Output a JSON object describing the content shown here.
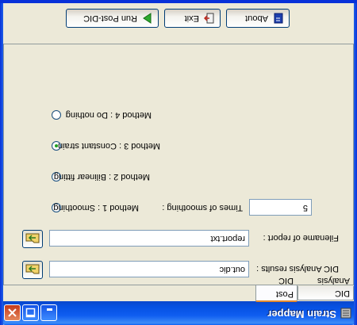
{
  "window": {
    "title": "Strain Mapper"
  },
  "tabs": [
    {
      "label": "DIC Analysis"
    },
    {
      "label": "Post DIC"
    }
  ],
  "fields": {
    "dic_results_label": "DIC Analysis results :",
    "dic_results_value": "out.dic",
    "report_label": "Filename of report :",
    "report_value": "report.txt",
    "smoothing_times_label": "Times of smoothing :",
    "smoothing_times_value": "5"
  },
  "methods": [
    {
      "label": "Method 1 : Smoothing",
      "selected": false
    },
    {
      "label": "Method 2 : Bilinear fitting",
      "selected": false
    },
    {
      "label": "Method 3 : Constant strain",
      "selected": true
    },
    {
      "label": "Method 4 : Do nothing",
      "selected": false
    }
  ],
  "buttons": {
    "about": "About",
    "exit": "Exit",
    "run": "Run Post-DIC"
  },
  "colors": {
    "titlebar": "#0a5ef5",
    "panel_bg": "#ece9d8",
    "field_border": "#7f9db9",
    "tab_active_accent": "#e68b2c",
    "radio_selected": "#21a121"
  },
  "icons": {
    "app": "strain-mapper-app-icon",
    "browse": "folder-browse-icon",
    "about": "about-book-icon",
    "exit": "exit-door-icon",
    "run": "play-arrow-icon"
  }
}
